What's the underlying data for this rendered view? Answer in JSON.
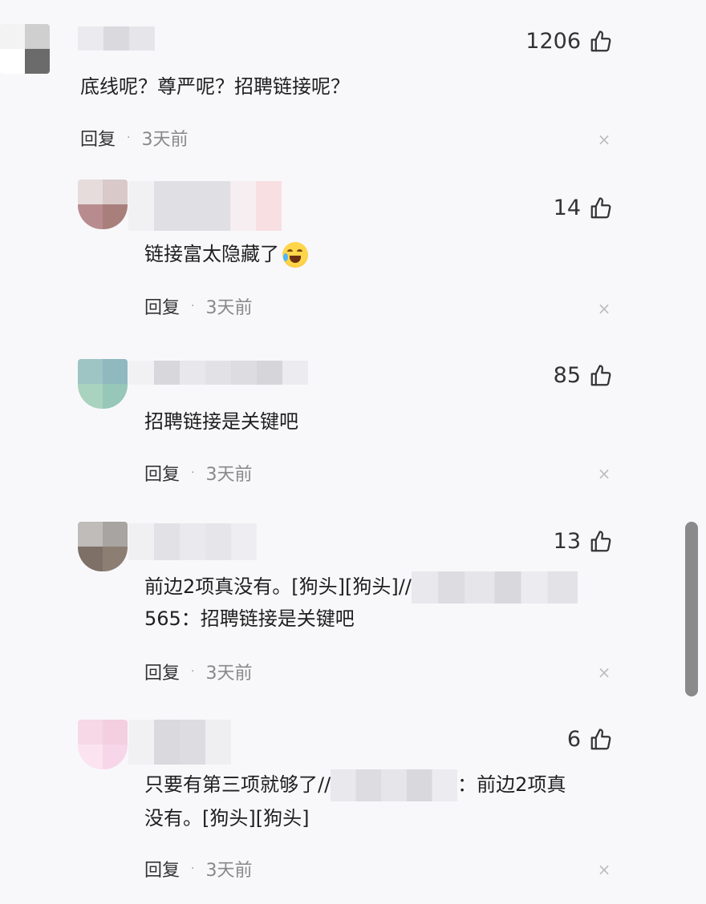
{
  "comments": [
    {
      "likes": "1206",
      "text": "底线呢？尊严呢？招聘链接呢？",
      "reply": "回复",
      "dot": "·",
      "time": "3天前",
      "close": "×"
    },
    {
      "likes": "14",
      "text": "链接富太隐藏了",
      "reply": "回复",
      "dot": "·",
      "time": "3天前",
      "close": "×",
      "emoji": "crying-laughing-emoji"
    },
    {
      "likes": "85",
      "text": "招聘链接是关键吧",
      "reply": "回复",
      "dot": "·",
      "time": "3天前",
      "close": "×"
    },
    {
      "likes": "13",
      "text_line1": "前边2项真没有。[狗头][狗头]//",
      "text_line2": "565：招聘链接是关键吧",
      "reply": "回复",
      "dot": "·",
      "time": "3天前",
      "close": "×"
    },
    {
      "likes": "6",
      "text_line1a": "只要有第三项就够了//",
      "text_line1b": "：前边2项真",
      "text_line2": "没有。[狗头][狗头]",
      "reply": "回复",
      "dot": "·",
      "time": "3天前",
      "close": "×"
    }
  ],
  "colors": {
    "background": "#f8f8fb",
    "scrollbar": "#8a8a8a"
  },
  "icons": {
    "like": "thumbs-up-icon",
    "close": "close-icon"
  }
}
